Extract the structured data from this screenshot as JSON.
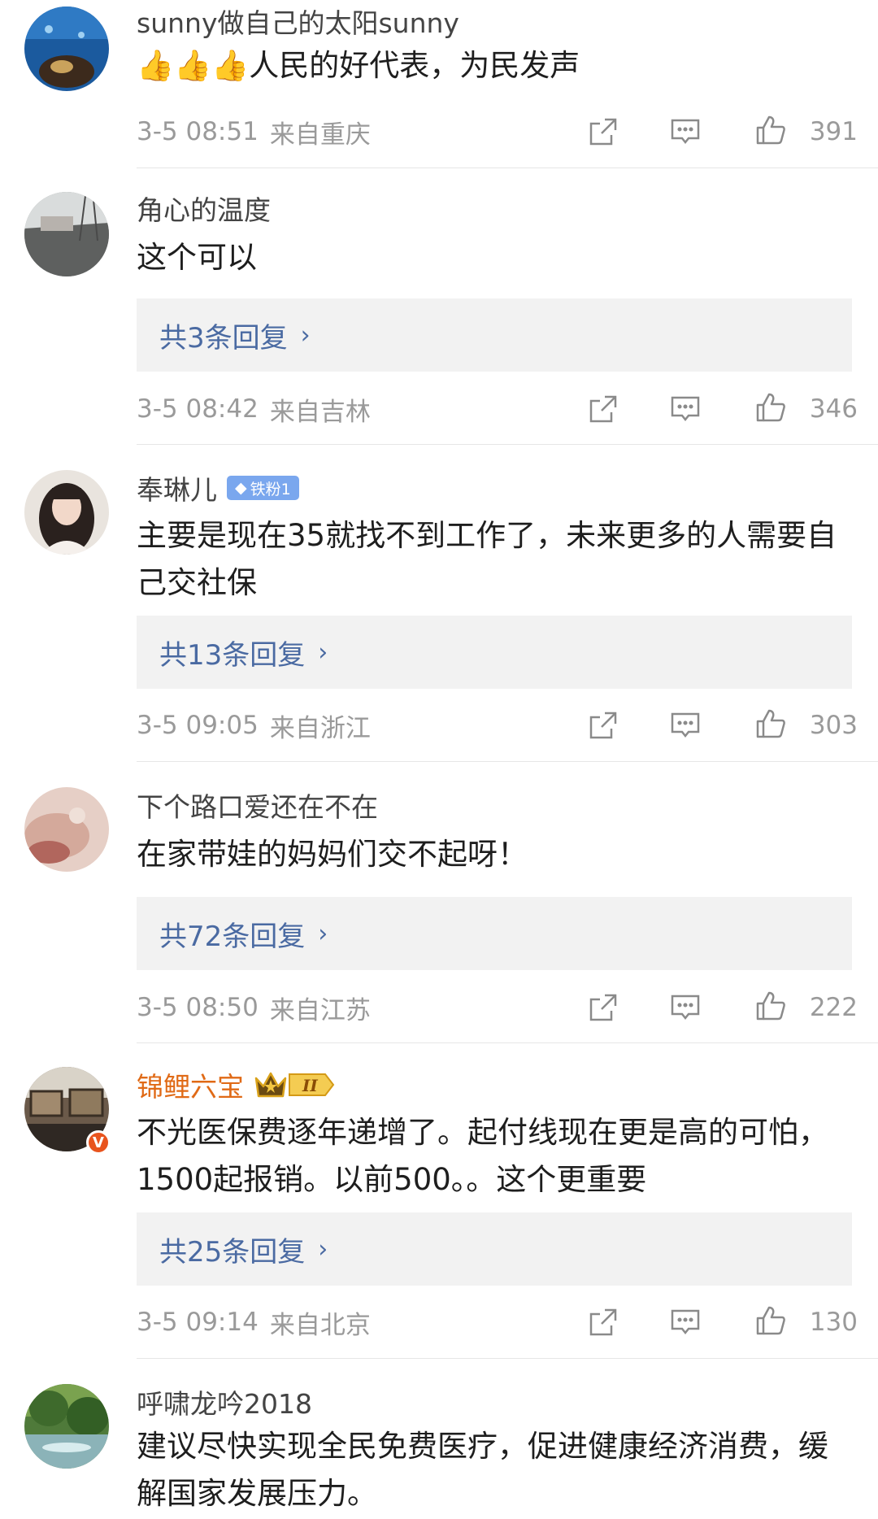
{
  "comments": [
    {
      "username": "sunny做自己的太阳sunny",
      "text": "👍👍👍人民的好代表，为民发声",
      "time": "3-5 08:51",
      "location": "来自重庆",
      "likes": "391"
    },
    {
      "username": "角心的温度",
      "text": "这个可以",
      "replies": "共3条回复",
      "time": "3-5 08:42",
      "location": "来自吉林",
      "likes": "346"
    },
    {
      "username": "奉琳儿",
      "badge": "铁粉1",
      "text": "主要是现在35就找不到工作了，未来更多的人需要自己交社保",
      "replies": "共13条回复",
      "time": "3-5 09:05",
      "location": "来自浙江",
      "likes": "303"
    },
    {
      "username": "下个路口爱还在不在",
      "text": "在家带娃的妈妈们交不起呀！",
      "replies": "共72条回复",
      "time": "3-5 08:50",
      "location": "来自江苏",
      "likes": "222"
    },
    {
      "username": "锦鲤六宝",
      "badge": "II",
      "text": "不光医保费逐年递增了。起付线现在更是高的可怕，1500起报销。以前500。。这个更重要",
      "replies": "共25条回复",
      "time": "3-5 09:14",
      "location": "来自北京",
      "likes": "130"
    },
    {
      "username": "呼啸龙吟2018",
      "text": "建议尽快实现全民免费医疗，促进健康经济消费，缓解国家发展压力。"
    }
  ],
  "colors": {
    "link": "#4a6aa2",
    "vip_name": "#e06a16",
    "meta": "#9a9a9a"
  },
  "icons": {
    "share": "share-icon",
    "comment": "comment-icon",
    "like": "thumbs-up-icon",
    "chevron": "chevron-right-icon",
    "verified": "verified-v-icon"
  }
}
